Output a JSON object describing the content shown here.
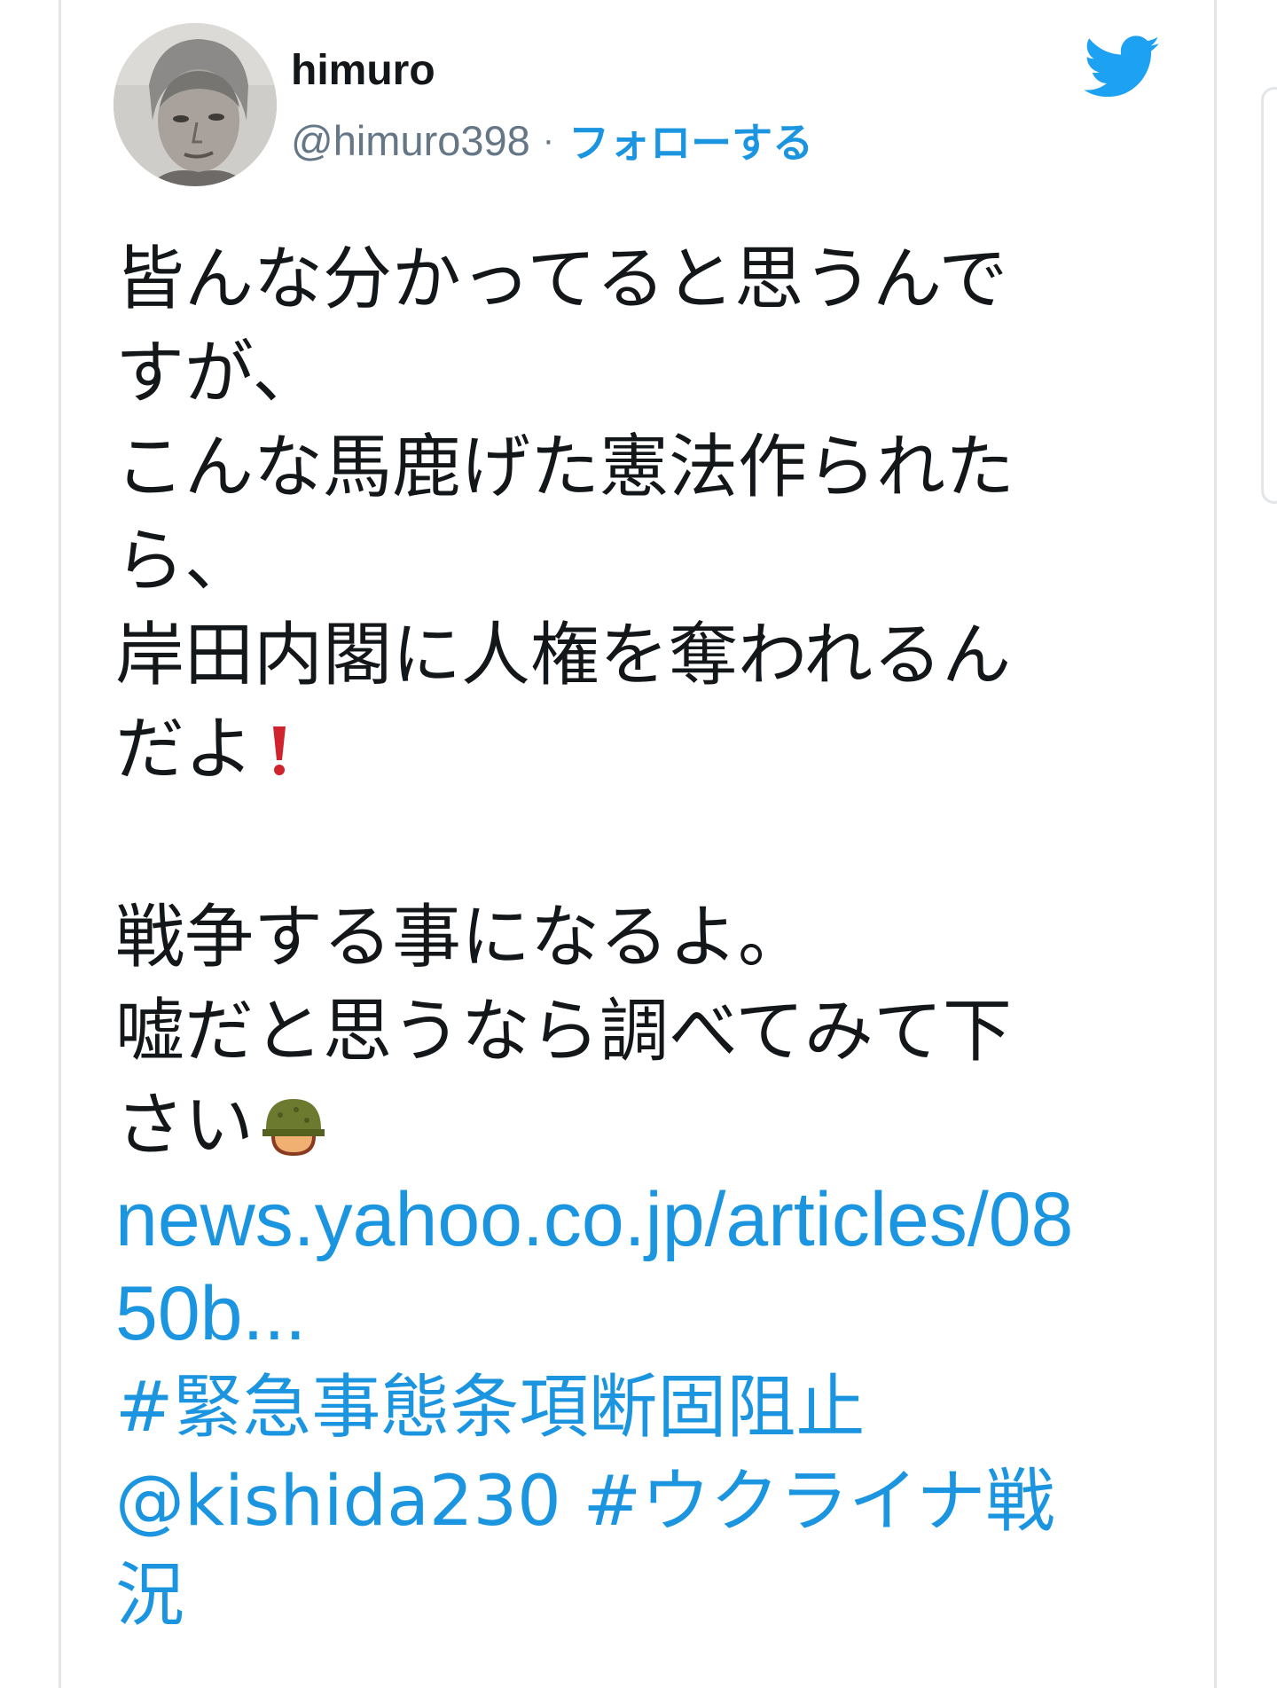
{
  "tweet": {
    "author_name": "himuro",
    "author_handle": "@himuro398",
    "separator": "·",
    "follow_label": "フォローする",
    "text_lines": [
      "皆んな分かってると思うんで",
      "すが、",
      "こんな馬鹿げた憲法作られた",
      "ら、",
      "岸田内閣に人権を奪われるん",
      "だよ",
      "戦争する事になるよ。",
      "嘘だと思うなら調べてみて下",
      "さい"
    ],
    "link_lines": [
      "news.yahoo.co.jp/articles/08",
      "50b..."
    ],
    "hashtag_1": "#緊急事態条項断固阻止",
    "mention": "@kishida230",
    "hashtag_2_part1": "#ウクライナ戦",
    "hashtag_2_part2": "況"
  },
  "icons": {
    "avatar": "profile-photo",
    "brand_icon": "twitter-bird-icon",
    "emoji_1": "red-exclamation-emoji",
    "emoji_2": "military-helmet-emoji"
  },
  "colors": {
    "text": "#14171a",
    "secondary": "#657786",
    "link": "#1b95e0",
    "twitter_blue": "#1da1f2",
    "border": "#e3e6e8"
  }
}
